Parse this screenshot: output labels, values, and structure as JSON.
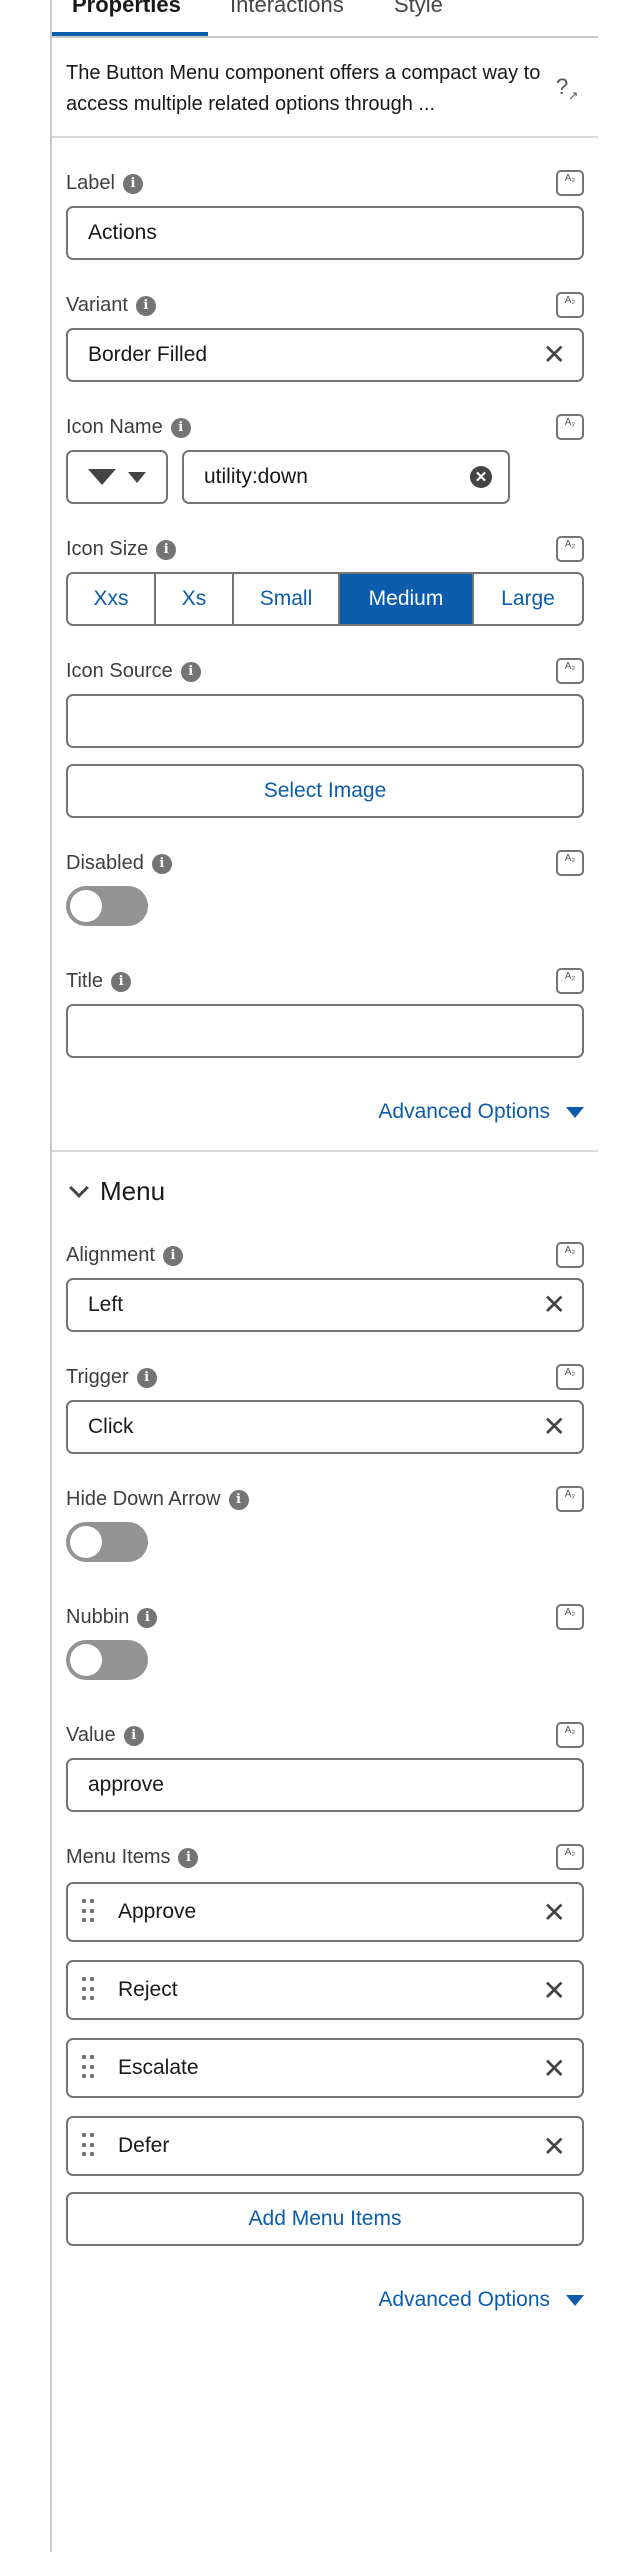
{
  "tabs": [
    "Properties",
    "Interactions",
    "Style"
  ],
  "description": "The Button Menu component offers a compact way to access multiple related options through ...",
  "help_icon_text": "?",
  "bind_icon_text": "A₂",
  "info_glyph": "i",
  "fields": {
    "label": {
      "label": "Label",
      "value": "Actions"
    },
    "variant": {
      "label": "Variant",
      "value": "Border Filled"
    },
    "icon_name": {
      "label": "Icon Name",
      "value": "utility:down"
    },
    "icon_size": {
      "label": "Icon Size",
      "options": [
        "Xxs",
        "Xs",
        "Small",
        "Medium",
        "Large"
      ],
      "selected": "Medium"
    },
    "icon_source": {
      "label": "Icon Source",
      "value": "",
      "button": "Select Image"
    },
    "disabled": {
      "label": "Disabled",
      "checked": false
    },
    "title": {
      "label": "Title",
      "value": ""
    }
  },
  "advanced_options": "Advanced Options",
  "menu_section": {
    "title": "Menu",
    "alignment": {
      "label": "Alignment",
      "value": "Left"
    },
    "trigger": {
      "label": "Trigger",
      "value": "Click"
    },
    "hide_down_arrow": {
      "label": "Hide Down Arrow",
      "checked": false
    },
    "nubbin": {
      "label": "Nubbin",
      "checked": false
    },
    "value": {
      "label": "Value",
      "value": "approve"
    },
    "menu_items": {
      "label": "Menu Items",
      "items": [
        "Approve",
        "Reject",
        "Escalate",
        "Defer"
      ],
      "add_button": "Add Menu Items"
    },
    "advanced_options": "Advanced Options"
  },
  "clear_glyph": "✕",
  "colors": {
    "accent": "#0b5cab",
    "border": "#747474",
    "toggle_off": "#939393"
  }
}
